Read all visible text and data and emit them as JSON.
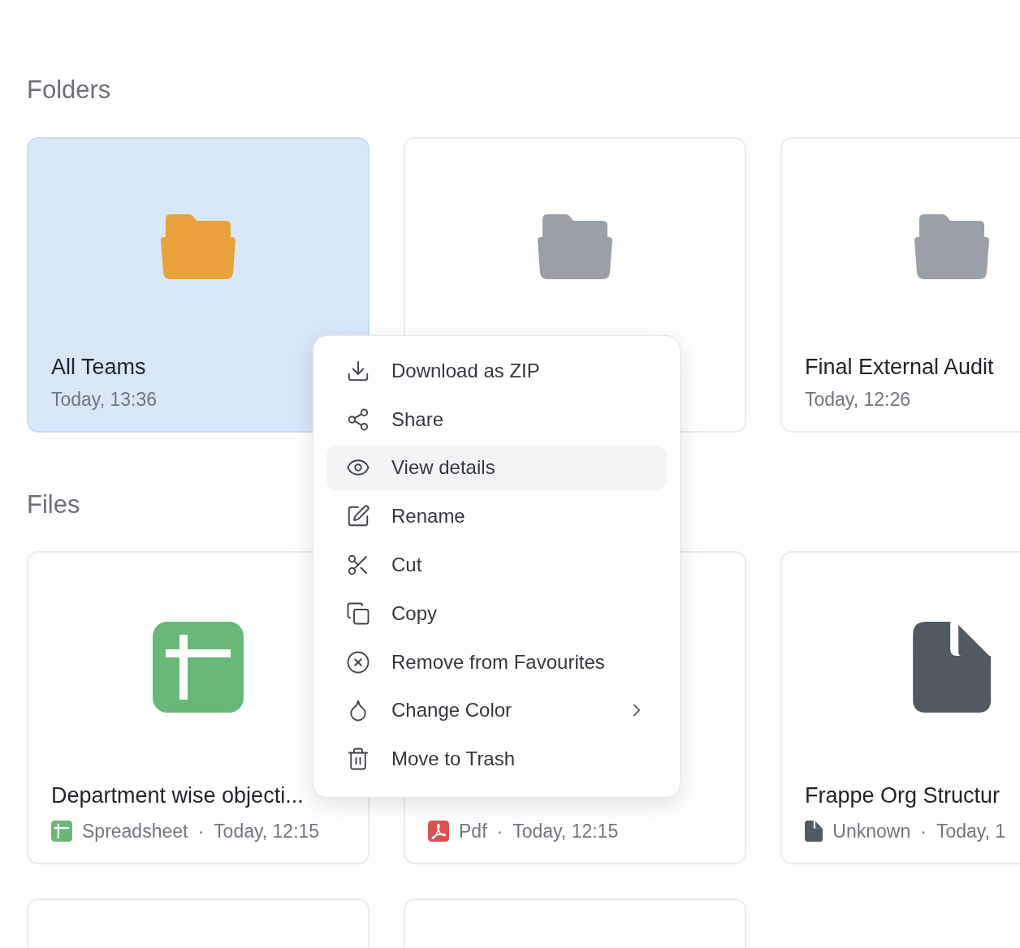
{
  "folders_section": {
    "title": "Folders"
  },
  "folders": [
    {
      "name": "All Teams",
      "date": "Today, 13:36",
      "color": "#e9a23b",
      "selected": true
    },
    {
      "color": "#9aa0a8",
      "selected": false
    },
    {
      "name": "Final External Audit",
      "date": "Today, 12:26",
      "color": "#9aa0a8",
      "selected": false
    }
  ],
  "files_section": {
    "title": "Files"
  },
  "files": [
    {
      "kind": "spreadsheet",
      "name": "Department wise objecti...",
      "type": "Spreadsheet",
      "separator": "·",
      "date": "Today, 12:15"
    },
    {
      "kind": "pdf",
      "type": "Pdf",
      "separator": "·",
      "date": "Today, 12:15"
    },
    {
      "kind": "unknown",
      "name": "Frappe Org Structur",
      "type": "Unknown",
      "separator": "·",
      "date": "Today, 1"
    }
  ],
  "context_menu": {
    "items": [
      {
        "label": "Download as ZIP",
        "selected": false
      },
      {
        "label": "Share",
        "selected": false
      },
      {
        "label": "View details",
        "selected": true
      },
      {
        "label": "Rename",
        "selected": false
      },
      {
        "label": "Cut",
        "selected": false
      },
      {
        "label": "Copy",
        "selected": false
      },
      {
        "label": "Remove from Favourites",
        "selected": false
      },
      {
        "label": "Change Color",
        "selected": false,
        "has_submenu": true
      },
      {
        "label": "Move to Trash",
        "selected": false
      }
    ]
  }
}
